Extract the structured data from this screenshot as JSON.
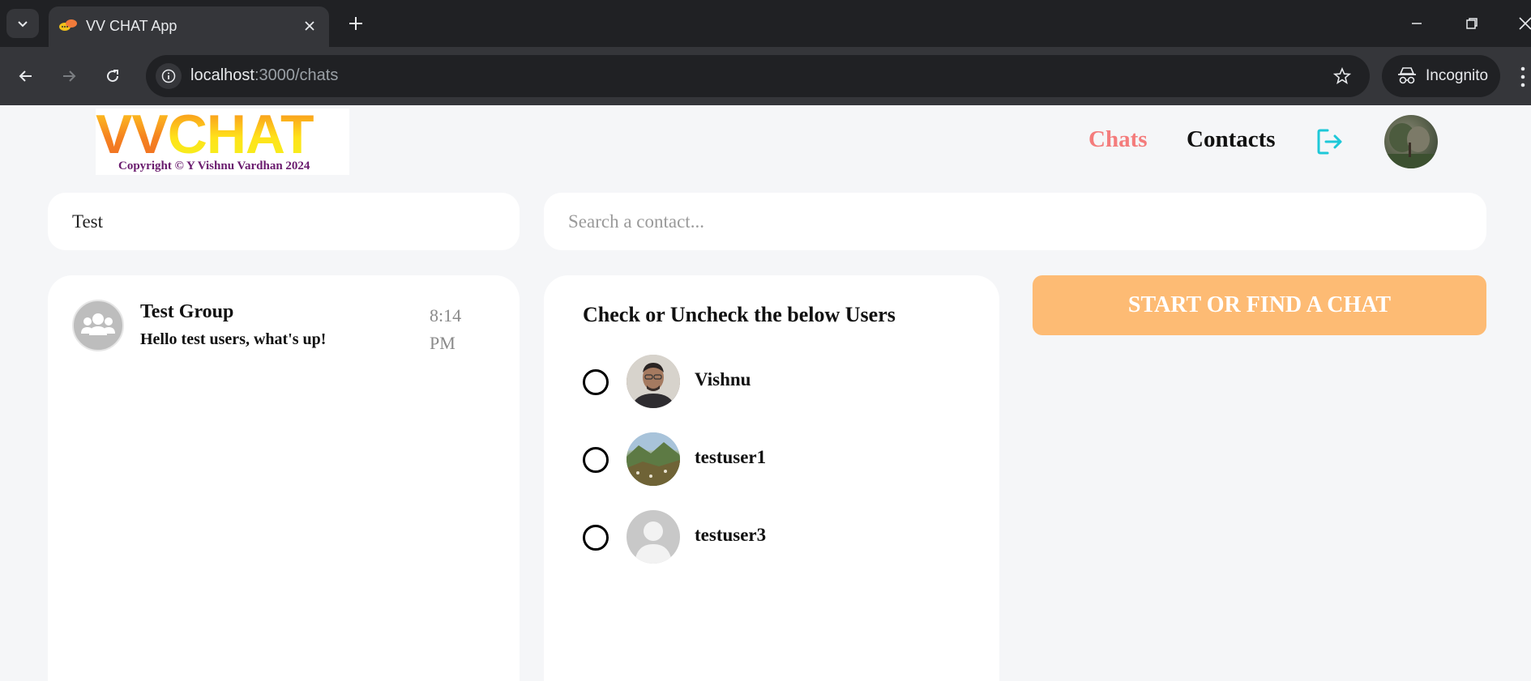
{
  "browser": {
    "tab_title": "VV CHAT App",
    "url_host": "localhost",
    "url_path": ":3000/chats",
    "incognito_label": "Incognito"
  },
  "header": {
    "logo_text_vv": "VV",
    "logo_text_chat": "CHAT",
    "logo_copyright": "Copyright © Y Vishnu Vardhan 2024",
    "nav_chats": "Chats",
    "nav_contacts": "Contacts",
    "active_color": "#f47c7c"
  },
  "search": {
    "chats_value": "Test",
    "contacts_placeholder": "Search a contact..."
  },
  "chats": [
    {
      "name": "Test Group",
      "last_message": "Hello test users, what's up!",
      "time": "8:14 PM",
      "avatar_icon": "group-icon"
    }
  ],
  "contacts_panel": {
    "title": "Check or Uncheck the below Users",
    "users": [
      {
        "name": "Vishnu",
        "checked": false
      },
      {
        "name": "testuser1",
        "checked": false
      },
      {
        "name": "testuser3",
        "checked": false
      }
    ]
  },
  "actions": {
    "start_chat_label": "START OR FIND A CHAT",
    "start_chat_color": "#fdbb74"
  }
}
